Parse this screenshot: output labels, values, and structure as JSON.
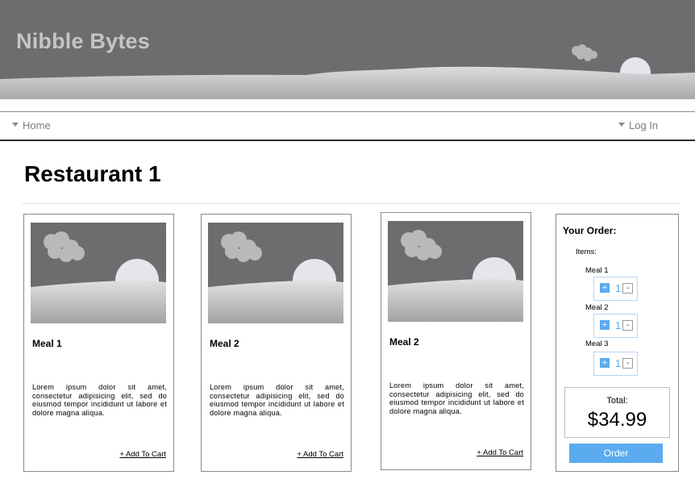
{
  "header": {
    "brand": "Nibble Bytes"
  },
  "nav": {
    "home": "Home",
    "login": "Log In"
  },
  "page": {
    "title": "Restaurant 1"
  },
  "meals": [
    {
      "name": "Meal 1",
      "description": "Lorem ipsum dolor sit amet, consectetur adipisicing elit, sed do eiusmod tempor incididunt ut labore et dolore magna aliqua.",
      "add_label": "+ Add To Cart"
    },
    {
      "name": "Meal 2",
      "description": "Lorem ipsum dolor sit amet, consectetur adipisicing elit, sed do eiusmod tempor incididunt ut labore et dolore magna aliqua.",
      "add_label": "+ Add To Cart"
    },
    {
      "name": "Meal 2",
      "description": "Lorem ipsum dolor sit amet, consectetur adipisicing elit, sed do eiusmod tempor incididunt ut labore et dolore magna aliqua.",
      "add_label": "+ Add To Cart"
    }
  ],
  "order": {
    "title": "Your Order:",
    "items_label": "Items:",
    "items": [
      {
        "name": "Meal 1",
        "qty": "1",
        "plus": "+",
        "minus": "-"
      },
      {
        "name": "Meal 2",
        "qty": "1",
        "plus": "+",
        "minus": "-"
      },
      {
        "name": "Meal 3",
        "qty": "1",
        "plus": "+",
        "minus": "-"
      }
    ],
    "total_label": "Total:",
    "total_value": "$34.99",
    "order_button": "Order"
  },
  "colors": {
    "accent": "#5aabf0",
    "banner": "#6d6d6f",
    "brand_text": "#c5c5c7"
  },
  "icons": {
    "nav_arrow": "caret-down-icon",
    "placeholder": "landscape-image-icon"
  }
}
